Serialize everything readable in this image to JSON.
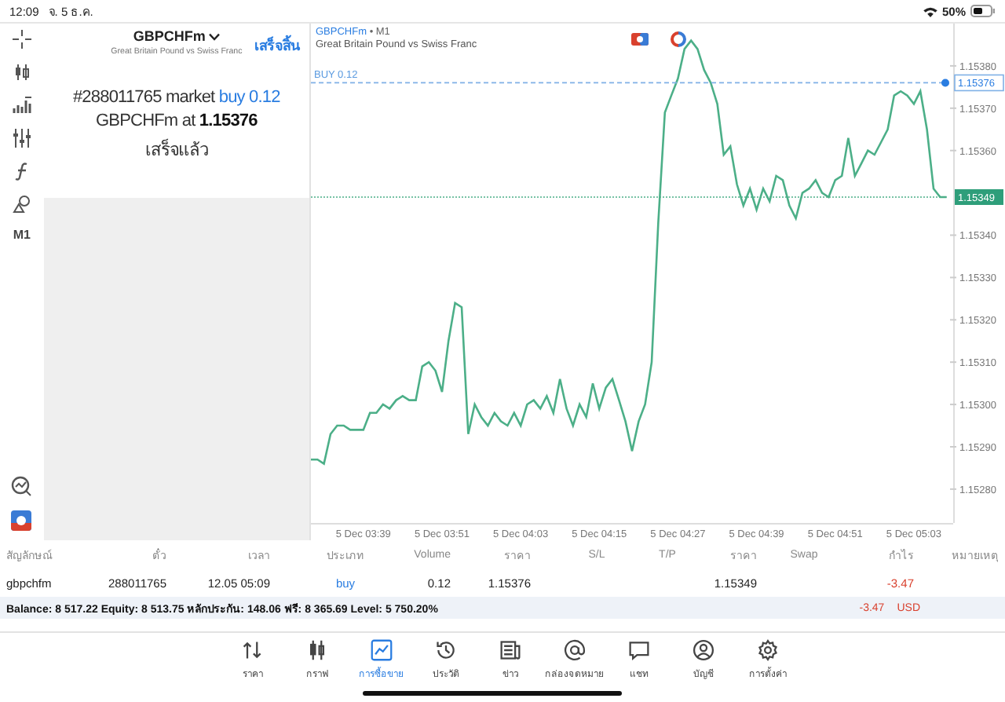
{
  "status_bar": {
    "time": "12:09",
    "date": "จ. 5 ธ.ค.",
    "battery": "50%"
  },
  "toolbar": {
    "timeframe": "M1"
  },
  "order_panel": {
    "symbol": "GBPCHFm",
    "description": "Great Britain Pound vs Swiss Franc",
    "done_button": "เสร็จสิ้น",
    "message": [
      "#288011765 market **buy 0.12**",
      "GBPCHFm at **1.15376**",
      "เสร็จแล้ว"
    ]
  },
  "chart": {
    "symbol": "GBPCHFm",
    "timeframe": "• M1",
    "description": "Great Britain Pound vs Swiss Franc",
    "order_line": {
      "price": "1.15376"
    },
    "bid_line": {
      "price": "1.15349"
    },
    "chart_data": {
      "type": "line",
      "ylim": [
        1.15272,
        1.1539
      ],
      "categories": [
        null,
        null,
        null,
        null,
        null,
        null,
        null,
        null,
        "5 Dec 03:39",
        null,
        null,
        null,
        null,
        null,
        null,
        null,
        null,
        null,
        null,
        null,
        "5 Dec 03:51",
        null,
        null,
        null,
        null,
        null,
        null,
        null,
        null,
        null,
        null,
        null,
        "5 Dec 04:03",
        null,
        null,
        null,
        null,
        null,
        null,
        null,
        null,
        null,
        null,
        null,
        "5 Dec 04:15",
        null,
        null,
        null,
        null,
        null,
        null,
        null,
        null,
        null,
        null,
        null,
        "5 Dec 04:27",
        null,
        null,
        null,
        null,
        null,
        null,
        null,
        null,
        null,
        null,
        null,
        "5 Dec 04:39",
        null,
        null,
        null,
        null,
        null,
        null,
        null,
        null,
        null,
        null,
        null,
        "5 Dec 04:51",
        null,
        null,
        null,
        null,
        null,
        null,
        null,
        null,
        null,
        null,
        null,
        "5 Dec 05:03",
        null,
        null,
        null,
        null,
        null
      ],
      "series": [
        {
          "color": "#4caf88",
          "values": [
            1.15287,
            1.15287,
            1.15286,
            1.15293,
            1.15295,
            1.15295,
            1.15294,
            1.15294,
            1.15294,
            1.15298,
            1.15298,
            1.153,
            1.15299,
            1.15301,
            1.15302,
            1.15301,
            1.15301,
            1.15309,
            1.1531,
            1.15308,
            1.15303,
            1.15315,
            1.15324,
            1.15323,
            1.15293,
            1.153,
            1.15297,
            1.15295,
            1.15298,
            1.15296,
            1.15295,
            1.15298,
            1.15295,
            1.153,
            1.15301,
            1.15299,
            1.15302,
            1.15298,
            1.15306,
            1.15299,
            1.15295,
            1.153,
            1.15297,
            1.15305,
            1.15299,
            1.15304,
            1.15306,
            1.15301,
            1.15296,
            1.15289,
            1.15296,
            1.153,
            1.1531,
            1.15343,
            1.15369,
            1.15373,
            1.15377,
            1.15384,
            1.15386,
            1.15384,
            1.15379,
            1.15376,
            1.15371,
            1.15359,
            1.15361,
            1.15352,
            1.15347,
            1.15351,
            1.15346,
            1.15351,
            1.15348,
            1.15354,
            1.15353,
            1.15347,
            1.15344,
            1.1535,
            1.15351,
            1.15353,
            1.1535,
            1.15349,
            1.15353,
            1.15354,
            1.15363,
            1.15354,
            1.15357,
            1.1536,
            1.15359,
            1.15362,
            1.15365,
            1.15373,
            1.15374,
            1.15373,
            1.15371,
            1.15374,
            1.15365,
            1.15351,
            1.15349,
            1.15349
          ]
        },
        {
          "name": "BUY 0.12",
          "color": "#7fb0e6",
          "line_style": "dashed",
          "values": [
            1.15376,
            1.15376,
            1.15376,
            1.15376,
            1.15376,
            1.15376,
            1.15376,
            1.15376,
            1.15376,
            1.15376,
            1.15376,
            1.15376,
            1.15376,
            1.15376,
            1.15376,
            1.15376,
            1.15376,
            1.15376,
            1.15376,
            1.15376,
            1.15376,
            1.15376,
            1.15376,
            1.15376,
            1.15376,
            1.15376,
            1.15376,
            1.15376,
            1.15376,
            1.15376,
            1.15376,
            1.15376,
            1.15376,
            1.15376,
            1.15376,
            1.15376,
            1.15376,
            1.15376,
            1.15376,
            1.15376,
            1.15376,
            1.15376,
            1.15376,
            1.15376,
            1.15376,
            1.15376,
            1.15376,
            1.15376,
            1.15376,
            1.15376,
            1.15376,
            1.15376,
            1.15376,
            1.15376,
            1.15376,
            1.15376,
            1.15376,
            1.15376,
            1.15376,
            1.15376,
            1.15376,
            1.15376,
            1.15376,
            1.15376,
            1.15376,
            1.15376,
            1.15376,
            1.15376,
            1.15376,
            1.15376,
            1.15376,
            1.15376,
            1.15376,
            1.15376,
            1.15376,
            1.15376,
            1.15376,
            1.15376,
            1.15376,
            1.15376,
            1.15376,
            1.15376,
            1.15376,
            1.15376,
            1.15376,
            1.15376,
            1.15376,
            1.15376,
            1.15376,
            1.15376,
            1.15376,
            1.15376,
            1.15376,
            1.15376,
            1.15376,
            1.15376,
            1.15376,
            1.15376
          ]
        },
        {
          "color": "#4caf88",
          "line_style": "dotted",
          "values": [
            1.15349,
            1.15349,
            1.15349,
            1.15349,
            1.15349,
            1.15349,
            1.15349,
            1.15349,
            1.15349,
            1.15349,
            1.15349,
            1.15349,
            1.15349,
            1.15349,
            1.15349,
            1.15349,
            1.15349,
            1.15349,
            1.15349,
            1.15349,
            1.15349,
            1.15349,
            1.15349,
            1.15349,
            1.15349,
            1.15349,
            1.15349,
            1.15349,
            1.15349,
            1.15349,
            1.15349,
            1.15349,
            1.15349,
            1.15349,
            1.15349,
            1.15349,
            1.15349,
            1.15349,
            1.15349,
            1.15349,
            1.15349,
            1.15349,
            1.15349,
            1.15349,
            1.15349,
            1.15349,
            1.15349,
            1.15349,
            1.15349,
            1.15349,
            1.15349,
            1.15349,
            1.15349,
            1.15349,
            1.15349,
            1.15349,
            1.15349,
            1.15349,
            1.15349,
            1.15349,
            1.15349,
            1.15349,
            1.15349,
            1.15349,
            1.15349,
            1.15349,
            1.15349,
            1.15349,
            1.15349,
            1.15349,
            1.15349,
            1.15349,
            1.15349,
            1.15349,
            1.15349,
            1.15349,
            1.15349,
            1.15349,
            1.15349,
            1.15349,
            1.15349,
            1.15349,
            1.15349,
            1.15349,
            1.15349,
            1.15349,
            1.15349,
            1.15349,
            1.15349,
            1.15349,
            1.15349,
            1.15349,
            1.15349,
            1.15349,
            1.15349,
            1.15349,
            1.15349,
            1.15349
          ]
        }
      ],
      "yticks": [
        {
          "value": 1.1528,
          "label": "1.15280"
        },
        {
          "value": 1.1529,
          "label": "1.15290"
        },
        {
          "value": 1.153,
          "label": "1.15300"
        },
        {
          "value": 1.1531,
          "label": "1.15310"
        },
        {
          "value": 1.1532,
          "label": "1.15320"
        },
        {
          "value": 1.1533,
          "label": "1.15330"
        },
        {
          "value": 1.1534,
          "label": "1.15340"
        },
        {
          "value": 1.1536,
          "label": "1.15360"
        },
        {
          "value": 1.1537,
          "label": "1.15370"
        },
        {
          "value": 1.1538,
          "label": "1.15380"
        }
      ]
    }
  },
  "positions": {
    "columns": [
      "สัญลักษณ์",
      "ตั๋ว",
      "เวลา",
      "ประเภท",
      "Volume",
      "ราคา",
      "S/L",
      "T/P",
      "ราคา",
      "Swap",
      "กำไร",
      "หมายเหตุ"
    ],
    "rows": [
      {
        "symbol": "gbpchfm",
        "ticket": "288011765",
        "time": "12.05 05:09",
        "type": "buy",
        "volume": "0.12",
        "open_price": "1.15376",
        "current_price": "1.15349",
        "profit": "-3.47"
      }
    ],
    "summary": "Balance: 8 517.22 Equity: 8 513.75 หลักประกัน: 148.06 ฟรี: 8 365.69 Level: 5 750.20%",
    "total_profit": "-3.47",
    "currency": "USD"
  },
  "tabs": [
    {
      "label": "ราคา",
      "selected": false
    },
    {
      "label": "กราฟ",
      "selected": false
    },
    {
      "label": "การซื้อขาย",
      "selected": true
    },
    {
      "label": "ประวัติ",
      "selected": false
    },
    {
      "label": "ข่าว",
      "selected": false
    },
    {
      "label": "กล่องจดหมาย",
      "selected": false
    },
    {
      "label": "แชท",
      "selected": false
    },
    {
      "label": "บัญชี",
      "selected": false
    },
    {
      "label": "การตั้งค่า",
      "selected": false
    }
  ]
}
